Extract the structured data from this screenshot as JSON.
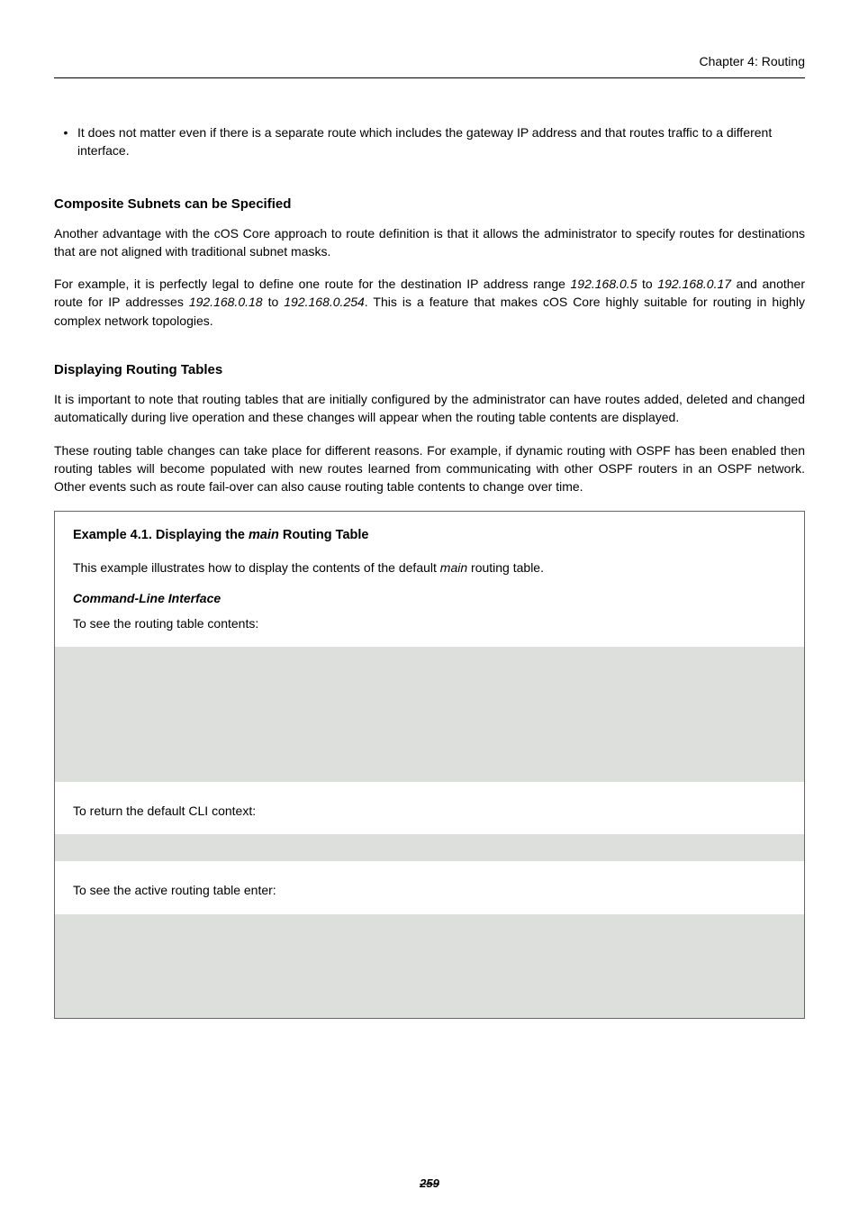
{
  "header": {
    "chapter": "Chapter 4: Routing"
  },
  "bullet": {
    "dot": "•",
    "text": "It does not matter even if there is a separate route which includes the gateway IP address and that routes traffic to a different interface."
  },
  "section1": {
    "heading": "Composite Subnets can be Specified",
    "p1_a": "Another advantage with the cOS Core approach to route definition is that it allows the administrator to specify routes for destinations that are not aligned with traditional subnet masks.",
    "p2_a": "For example, it is perfectly legal to define one route for the destination IP address range ",
    "ip1": "192.168.0.5",
    "p2_b": " to ",
    "ip2": "192.168.0.17",
    "p2_c": " and another route for IP addresses ",
    "ip3": "192.168.0.18",
    "p2_d": " to ",
    "ip4": "192.168.0.254",
    "p2_e": ". This is a feature that makes cOS Core highly suitable for routing in highly complex network topologies."
  },
  "section2": {
    "heading": "Displaying Routing Tables",
    "p1": "It is important to note that routing tables that are initially configured by the administrator can have routes added, deleted and changed automatically during live operation and these changes will appear when the routing table contents are displayed.",
    "p2": "These routing table changes can take place for different reasons. For example, if dynamic routing with OSPF has been enabled then routing tables will become populated with new routes learned from communicating with other OSPF routers in an OSPF network. Other events such as route fail-over can also cause routing table contents to change over time."
  },
  "example": {
    "label_a": "Example 4.1. Displaying the ",
    "label_em": "main",
    "label_b": " Routing Table",
    "intro_a": "This example illustrates how to display the contents of the default ",
    "intro_em": "main",
    "intro_b": " routing table.",
    "cli_heading": "Command-Line Interface",
    "step1": "To see the routing table contents:",
    "step2": "To return the default CLI context:",
    "step3": "To see the active routing table enter:"
  },
  "footer": {
    "page_number": "259"
  },
  "chart_data": null
}
